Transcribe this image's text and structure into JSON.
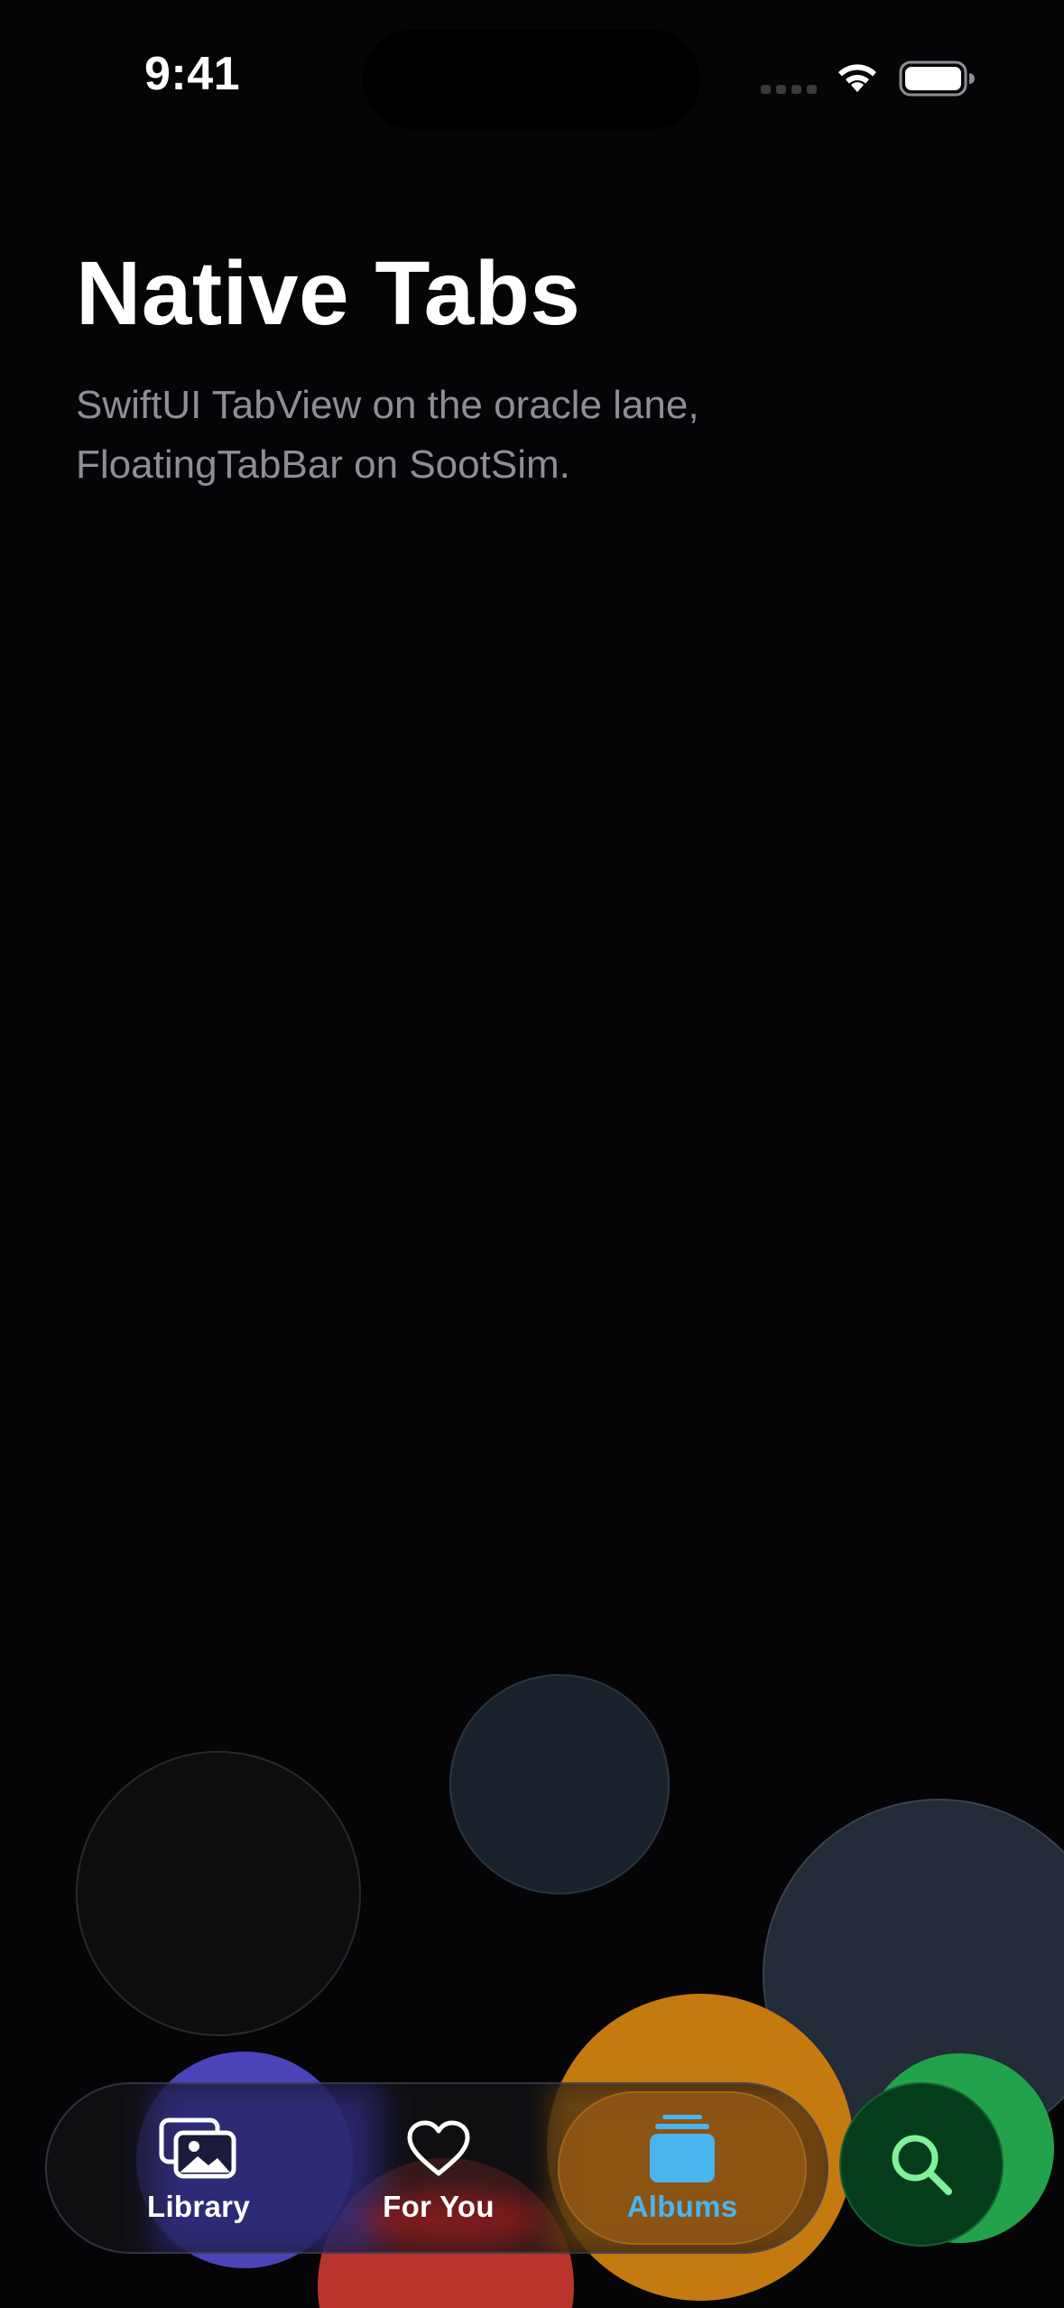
{
  "status_bar": {
    "time": "9:41",
    "signal_icon": "signal-dots-icon",
    "wifi_icon": "wifi-icon",
    "battery_icon": "battery-icon"
  },
  "header": {
    "title": "Native Tabs",
    "subtitle": "SwiftUI TabView on the oracle lane, FloatingTabBar on SootSim."
  },
  "tab_bar": {
    "selected": "Albums",
    "tabs": [
      {
        "label": "Library",
        "icon": "photos-icon"
      },
      {
        "label": "For You",
        "icon": "heart-icon"
      },
      {
        "label": "Albums",
        "icon": "albums-stack-icon"
      }
    ],
    "accent_color": "#4ab4ef"
  },
  "search_button": {
    "icon": "search-icon",
    "color": "#7df29a"
  }
}
